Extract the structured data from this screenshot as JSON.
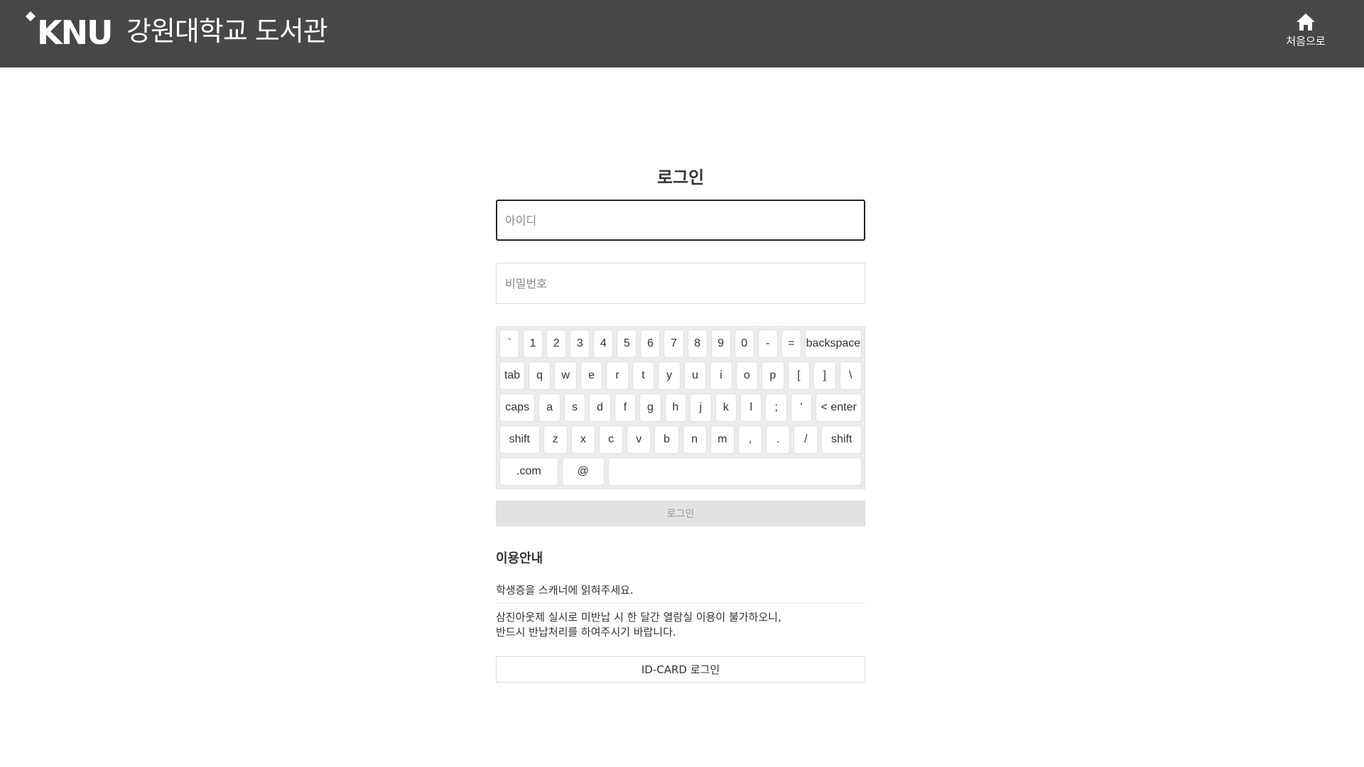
{
  "header": {
    "logo_mark": "KNU",
    "logo_text": "강원대학교 도서관",
    "home_label": "처음으로",
    "home_icon": "home-icon"
  },
  "login": {
    "title": "로그인",
    "id_placeholder": "아이디",
    "pw_placeholder": "비밀번호",
    "button_label": "로그인"
  },
  "keyboard": {
    "rows": [
      [
        "`",
        "1",
        "2",
        "3",
        "4",
        "5",
        "6",
        "7",
        "8",
        "9",
        "0",
        "-",
        "=",
        "backspace"
      ],
      [
        "tab",
        "q",
        "w",
        "e",
        "r",
        "t",
        "y",
        "u",
        "i",
        "o",
        "p",
        "[",
        "]",
        "\\"
      ],
      [
        "caps",
        "a",
        "s",
        "d",
        "f",
        "g",
        "h",
        "j",
        "k",
        "l",
        ";",
        "'",
        "< enter"
      ],
      [
        "shift",
        "z",
        "x",
        "c",
        "v",
        "b",
        "n",
        "m",
        ",",
        ".",
        "/",
        "shift"
      ],
      [
        ".com",
        "@",
        ""
      ]
    ]
  },
  "guide": {
    "title": "이용안내",
    "line1": "학생증을 스캐너에 읽혀주세요.",
    "line2a": "삼진아웃제 실시로 미반납 시 한 달간 열람실 이용이 불가하오니,",
    "line2b": "반드시 반납처리를 하여주시기 바랍니다."
  },
  "idcard_button": "ID-CARD 로그인"
}
